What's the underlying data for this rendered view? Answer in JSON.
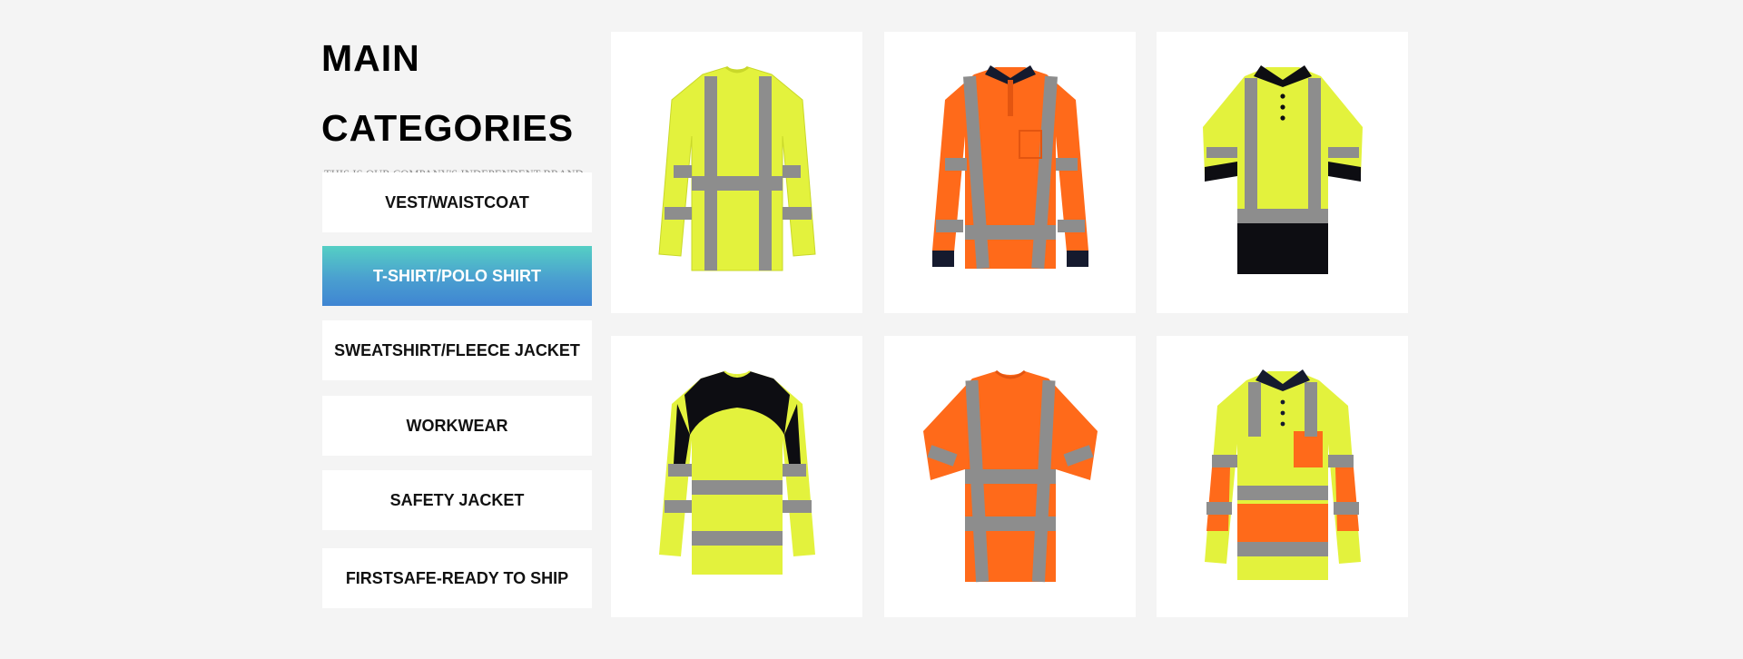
{
  "heading": {
    "line1": "MAIN",
    "line2": "CATEGORIES"
  },
  "subtitle": "THIS IS OUR COMPANY'S INDEPENDENT BRAND",
  "categories": [
    {
      "label": "VEST/WAISTCOAT",
      "active": false
    },
    {
      "label": "T-SHIRT/POLO SHIRT",
      "active": true
    },
    {
      "label": "SWEATSHIRT/FLEECE JACKET",
      "active": false
    },
    {
      "label": "WORKWEAR",
      "active": false
    },
    {
      "label": "SAFETY JACKET",
      "active": false
    },
    {
      "label": "FIRSTSAFE-READY TO SHIP",
      "active": false
    }
  ],
  "colors": {
    "hivis_yellow": "#dff23a",
    "hivis_orange": "#ff6a1a",
    "reflective_grey": "#8c8c8c",
    "navy": "#151a2e",
    "active_gradient_top": "#55cfc4",
    "active_gradient_bottom": "#3f85d2"
  },
  "products": [
    {
      "icon": "hi-vis-yellow-long-sleeve-tshirt-image"
    },
    {
      "icon": "hi-vis-orange-long-sleeve-polo-image"
    },
    {
      "icon": "hi-vis-yellow-navy-polo-image"
    },
    {
      "icon": "hi-vis-yellow-black-long-sleeve-tshirt-image"
    },
    {
      "icon": "hi-vis-orange-tshirt-image"
    },
    {
      "icon": "hi-vis-yellow-orange-long-sleeve-polo-image"
    }
  ]
}
